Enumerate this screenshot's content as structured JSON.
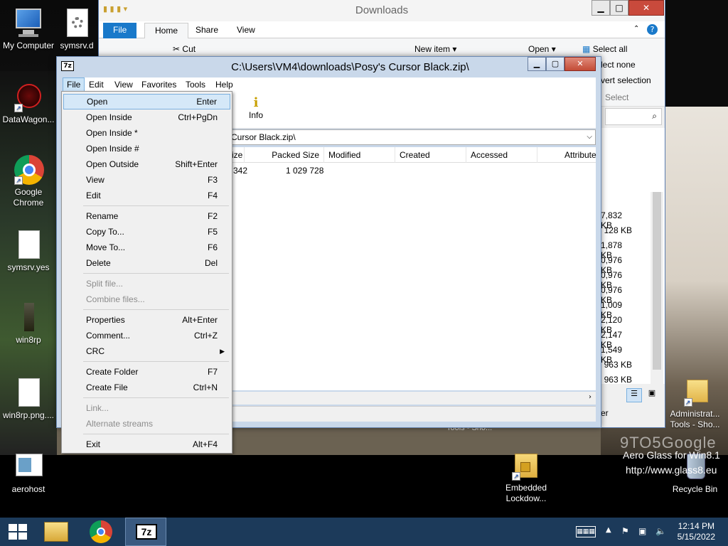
{
  "desktop": {
    "icons": [
      {
        "label": "My Computer"
      },
      {
        "label": "symsrv.d"
      },
      {
        "label": "DataWagon..."
      },
      {
        "label": "Google Chrome"
      },
      {
        "label": "symsrv.yes"
      },
      {
        "label": "win8rp"
      },
      {
        "label": "win8rp.png...."
      },
      {
        "label": "aerohost"
      },
      {
        "label": "Embedded Lockdow..."
      },
      {
        "label": "Recycle Bin"
      },
      {
        "label": "Administrat... Tools - Sho..."
      }
    ],
    "watermark": "9TO5Google",
    "aero_line1": "Aero Glass for Win8.1",
    "aero_line2": "http://www.glass8.eu"
  },
  "explorer": {
    "title": "Downloads",
    "tabs": {
      "file": "File",
      "home": "Home",
      "share": "Share",
      "view": "View"
    },
    "ribbon": {
      "cut": "Cut",
      "new_item": "New item",
      "open": "Open",
      "select_all": "Select all",
      "select_none": "lect none",
      "invert": "vert selection",
      "select_group": "Select"
    },
    "sizes": [
      "7,832 KB",
      "128 KB",
      "1,878 KB",
      "0,976 KB",
      "0,976 KB",
      "0,976 KB",
      "1,009 KB",
      "2,120 KB",
      "2,147 KB",
      "1,549 KB",
      "963 KB",
      "963 KB"
    ],
    "status_text": "er",
    "behind_label": "Tools - Sho..."
  },
  "sevenzip": {
    "title": "C:\\Users\\VM4\\downloads\\Posy's Cursor Black.zip\\",
    "logo": "7z",
    "menubar": [
      "File",
      "Edit",
      "View",
      "Favorites",
      "Tools",
      "Help"
    ],
    "toolbar_info": "Info",
    "toolbar_partial": "e",
    "address": "Cursor Black.zip\\",
    "columns": [
      "ize",
      "Packed Size",
      "Modified",
      "Created",
      "Accessed",
      "Attribute"
    ],
    "row": {
      "size": "342",
      "packed": "1 029 728"
    }
  },
  "file_menu": {
    "items": [
      {
        "label": "Open",
        "shortcut": "Enter"
      },
      {
        "label": "Open Inside",
        "shortcut": "Ctrl+PgDn"
      },
      {
        "label": "Open Inside *",
        "shortcut": ""
      },
      {
        "label": "Open Inside #",
        "shortcut": ""
      },
      {
        "label": "Open Outside",
        "shortcut": "Shift+Enter"
      },
      {
        "label": "View",
        "shortcut": "F3"
      },
      {
        "label": "Edit",
        "shortcut": "F4"
      },
      {
        "label": "Rename",
        "shortcut": "F2"
      },
      {
        "label": "Copy To...",
        "shortcut": "F5"
      },
      {
        "label": "Move To...",
        "shortcut": "F6"
      },
      {
        "label": "Delete",
        "shortcut": "Del"
      },
      {
        "label": "Split file...",
        "shortcut": ""
      },
      {
        "label": "Combine files...",
        "shortcut": ""
      },
      {
        "label": "Properties",
        "shortcut": "Alt+Enter"
      },
      {
        "label": "Comment...",
        "shortcut": "Ctrl+Z"
      },
      {
        "label": "CRC",
        "shortcut": ""
      },
      {
        "label": "Create Folder",
        "shortcut": "F7"
      },
      {
        "label": "Create File",
        "shortcut": "Ctrl+N"
      },
      {
        "label": "Link...",
        "shortcut": ""
      },
      {
        "label": "Alternate streams",
        "shortcut": ""
      },
      {
        "label": "Exit",
        "shortcut": "Alt+F4"
      }
    ]
  },
  "taskbar": {
    "time": "12:14 PM",
    "date": "5/15/2022",
    "sevenzip_label": "7z"
  },
  "colors": {
    "accent": "#1979ca",
    "taskbar": "#1c3a5a",
    "menu_highlight": "#d5e8f8"
  }
}
